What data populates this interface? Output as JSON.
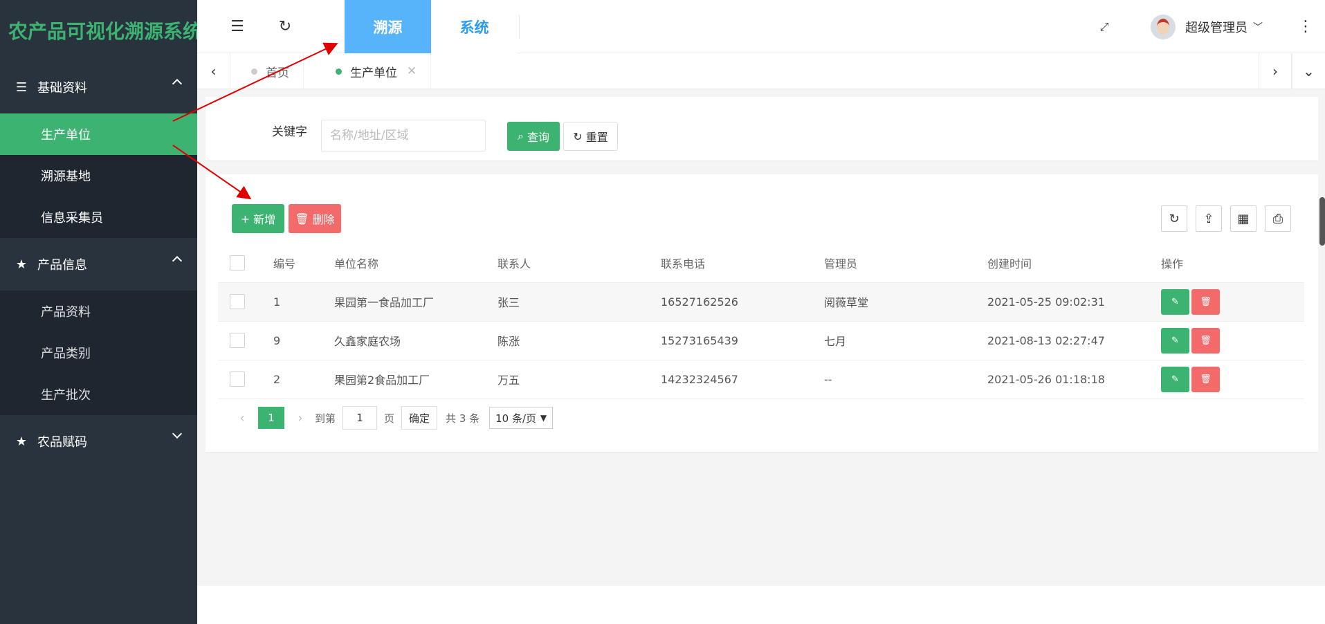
{
  "app": {
    "title": "农产品可视化溯源系统"
  },
  "sidebar": {
    "groups": [
      {
        "label": "基础资料",
        "items": [
          "生产单位",
          "溯源基地",
          "信息采集员"
        ]
      },
      {
        "label": "产品信息",
        "items": [
          "产品资料",
          "产品类别",
          "生产批次"
        ]
      },
      {
        "label": "农品赋码",
        "items": []
      }
    ]
  },
  "header": {
    "tabs": [
      "溯源",
      "系统"
    ],
    "user": "超级管理员"
  },
  "page_tabs": {
    "items": [
      "首页",
      "生产单位"
    ]
  },
  "search": {
    "label": "关键字",
    "placeholder": "名称/地址/区域",
    "query_label": "查询",
    "reset_label": "重置"
  },
  "toolbar": {
    "add_label": "新增",
    "delete_label": "删除"
  },
  "table": {
    "headers": [
      "编号",
      "单位名称",
      "联系人",
      "联系电话",
      "管理员",
      "创建时间",
      "操作"
    ],
    "rows": [
      [
        "1",
        "果园第一食品加工厂",
        "张三",
        "16527162526",
        "阅薇草堂",
        "2021-05-25 09:02:31"
      ],
      [
        "9",
        "久鑫家庭农场",
        "陈涨",
        "15273165439",
        "七月",
        "2021-08-13 02:27:47"
      ],
      [
        "2",
        "果园第2食品加工厂",
        "万五",
        "14232324567",
        "--",
        "2021-05-26 01:18:18"
      ]
    ]
  },
  "pager": {
    "current": "1",
    "goto_label": "到第",
    "goto_value": "1",
    "page_unit": "页",
    "confirm_label": "确定",
    "total_label": "共 3 条",
    "page_size": "10 条/页"
  },
  "colors": {
    "accent": "#3cb371",
    "danger": "#f26a6a",
    "sidebar": "#28333e",
    "tab_active": "#58b4fa",
    "link": "#2d9cf0"
  }
}
